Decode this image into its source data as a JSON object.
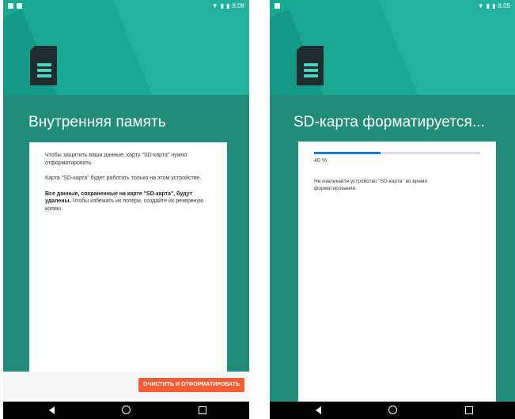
{
  "screen1": {
    "status": {
      "time": "8:08"
    },
    "title": "Внутренняя память",
    "paragraphs": [
      "Чтобы защитить ваши данные, карту \"SD-карта\" нужно отформатировать.",
      "Карта \"SD-карта\" будет работать только на этом устройстве."
    ],
    "warning_bold": "Все данные, сохраненные на карте \"SD-карта\", будут удалены.",
    "warning_rest": " Чтобы избежать их потери, создайте их резервную копию.",
    "action_button": "ОЧИСТИТЬ И ОТФОРМАТИРОВАТЬ"
  },
  "screen2": {
    "status": {
      "time": "8:09"
    },
    "title": "SD-карта форматируется...",
    "progress_percent": 40,
    "progress_label": "40 %",
    "note": "Не извлекайте устройство \"SD-карта\" во время форматирования."
  },
  "colors": {
    "teal": "#218c78",
    "accent": "#f45d34",
    "progress": "#1e7bd6"
  },
  "icons": [
    "sd-card-icon",
    "wifi-icon",
    "signal-icon",
    "battery-icon",
    "back-icon",
    "home-icon",
    "recent-apps-icon"
  ]
}
